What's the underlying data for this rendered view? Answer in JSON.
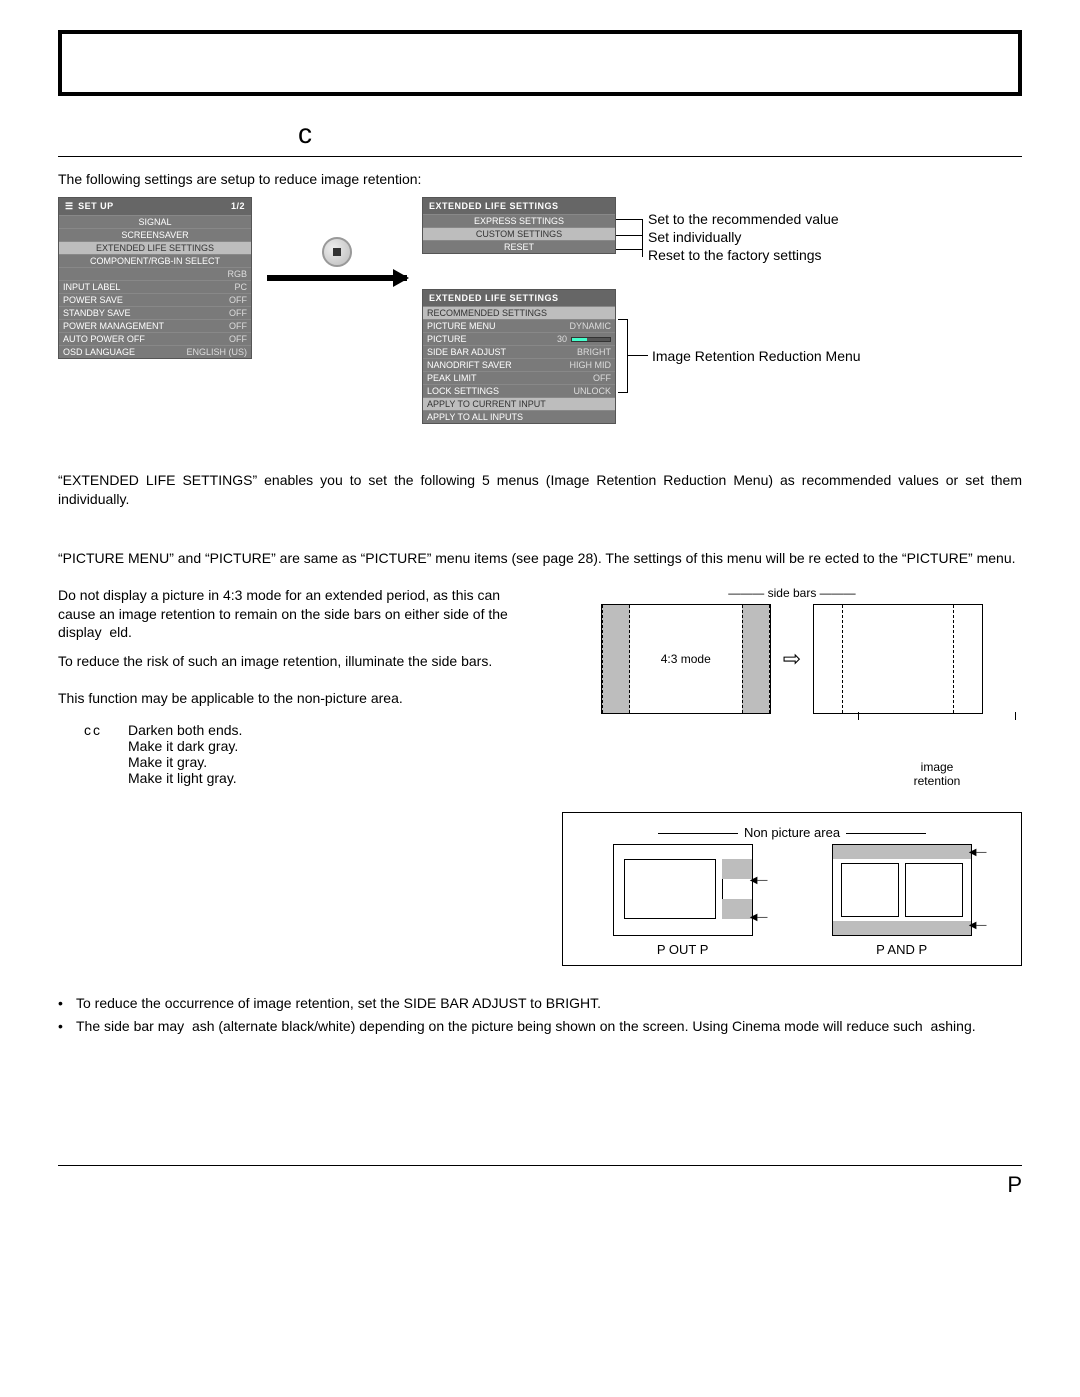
{
  "page": {
    "c_label": "c",
    "intro": "The following settings are setup to reduce image retention:",
    "footer": "P"
  },
  "setup_menu": {
    "title": "SET UP",
    "page": "1/2",
    "rows_center": [
      "SIGNAL",
      "SCREENSAVER",
      "EXTENDED LIFE SETTINGS",
      "COMPONENT/RGB-IN SELECT"
    ],
    "rows_kv": [
      {
        "k": "",
        "v": "RGB"
      },
      {
        "k": "INPUT LABEL",
        "v": "PC"
      },
      {
        "k": "POWER SAVE",
        "v": "OFF"
      },
      {
        "k": "STANDBY SAVE",
        "v": "OFF"
      },
      {
        "k": "POWER MANAGEMENT",
        "v": "OFF"
      },
      {
        "k": "AUTO POWER OFF",
        "v": "OFF"
      },
      {
        "k": "OSD LANGUAGE",
        "v": "ENGLISH (US)"
      }
    ]
  },
  "ext_menu1": {
    "title": "EXTENDED LIFE SETTINGS",
    "rows": [
      "EXPRESS SETTINGS",
      "CUSTOM SETTINGS",
      "RESET"
    ]
  },
  "ext_menu2": {
    "title": "EXTENDED LIFE SETTINGS",
    "header": "RECOMMENDED SETTINGS",
    "rows": [
      {
        "k": "PICTURE MENU",
        "v": "DYNAMIC"
      },
      {
        "k": "PICTURE",
        "v": "30",
        "slider": true
      },
      {
        "k": "SIDE BAR ADJUST",
        "v": "BRIGHT"
      },
      {
        "k": "NANODRIFT SAVER",
        "v": "HIGH MID"
      },
      {
        "k": "PEAK LIMIT",
        "v": "OFF"
      },
      {
        "k": "LOCK SETTINGS",
        "v": "UNLOCK"
      }
    ],
    "footer_rows": [
      "APPLY TO CURRENT INPUT",
      "APPLY TO ALL INPUTS"
    ]
  },
  "callouts": {
    "recommended": "Set to the recommended value",
    "individually": "Set individually",
    "reset": "Reset to the factory settings",
    "irr_menu": "Image Retention Reduction Menu"
  },
  "body": {
    "ext_para": "“EXTENDED LIFE SETTINGS” enables you to set the following 5 menus (Image Retention Reduction Menu) as recommended values or set them individually.",
    "pic_para": "“PICTURE MENU” and “PICTURE” are same as “PICTURE” menu items (see page 28). The settings of this menu will be re ected to the “PICTURE” menu.",
    "sb_para1": "Do not display a picture in 4:3 mode for an extended period, as this can cause an image retention to remain on the side bars on either side of the display  eld.",
    "sb_para2": "To reduce the risk of such an image retention, illuminate the side bars.",
    "sb_para3": "This function may be applicable to the non-picture area.",
    "legend": [
      {
        "k": "cc",
        "v": "Darken both ends."
      },
      {
        "k": "",
        "v": "Make it dark gray."
      },
      {
        "k": "",
        "v": "Make it gray."
      },
      {
        "k": "",
        "v": "Make it light gray."
      }
    ]
  },
  "diagram": {
    "side_bars": "side bars",
    "mode": "4:3 mode",
    "image_retention": "image\nretention",
    "non_picture": "Non picture area",
    "pop": "P OUT P",
    "pap": "P AND P"
  },
  "bullets": [
    "To reduce the occurrence of image retention, set the SIDE BAR ADJUST to BRIGHT.",
    "The side bar may  ash (alternate black/white) depending on the picture being shown on the screen. Using Cinema mode will reduce such  ashing."
  ]
}
